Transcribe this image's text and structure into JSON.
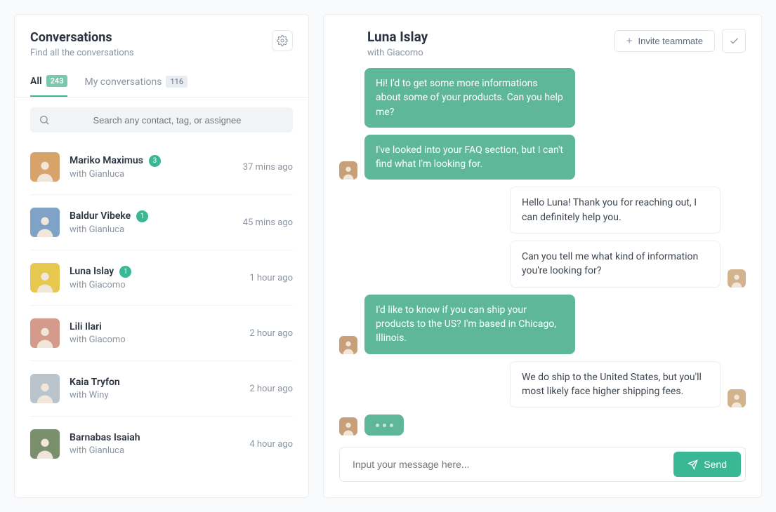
{
  "sidebar": {
    "title": "Conversations",
    "subtitle": "Find all the conversations",
    "tabs": [
      {
        "label": "All",
        "count": "243"
      },
      {
        "label": "My conversations",
        "count": "116"
      }
    ],
    "search_placeholder": "Search any contact, tag, or assignee",
    "conversations": [
      {
        "name": "Mariko Maximus",
        "with": "with Gianluca",
        "unread": "3",
        "time": "37 mins ago",
        "avatar_bg": "#d7a36b"
      },
      {
        "name": "Baldur Vibeke",
        "with": "with Gianluca",
        "unread": "1",
        "time": "45 mins ago",
        "avatar_bg": "#7fa2c7"
      },
      {
        "name": "Luna Islay",
        "with": "with Giacomo",
        "unread": "1",
        "time": "1 hour ago",
        "avatar_bg": "#e7c84e"
      },
      {
        "name": "Lili Ilari",
        "with": "with Giacomo",
        "unread": "",
        "time": "2 hour ago",
        "avatar_bg": "#d49a8b"
      },
      {
        "name": "Kaia Tryfon",
        "with": "with Winy",
        "unread": "",
        "time": "2 hour ago",
        "avatar_bg": "#b9c4cc"
      },
      {
        "name": "Barnabas Isaiah",
        "with": "with Gianluca",
        "unread": "",
        "time": "4 hour ago",
        "avatar_bg": "#7a8f6b"
      }
    ]
  },
  "chat": {
    "title": "Luna Islay",
    "subtitle": "with Giacomo",
    "invite_label": "Invite teammate",
    "messages": [
      {
        "side": "left",
        "color": "green",
        "text": "Hi! I'd to get some more informations about some of your products. Can you help me?",
        "avatar": false
      },
      {
        "side": "left",
        "color": "green",
        "text": "I've looked into your FAQ section, but I can't find what I'm looking for.",
        "avatar": true,
        "avatar_bg": "#c7a07a"
      },
      {
        "side": "right",
        "color": "white",
        "text": "Hello Luna! Thank you for reaching out, I can definitely help you.",
        "avatar": false
      },
      {
        "side": "right",
        "color": "white",
        "text": "Can you tell me what kind of information you're looking for?",
        "avatar": true,
        "avatar_bg": "#d2b38e"
      },
      {
        "side": "left",
        "color": "green",
        "text": "I'd like to know if you can ship your products to the US? I'm based in Chicago, Illinois.",
        "avatar": true,
        "avatar_bg": "#c7a07a"
      },
      {
        "side": "right",
        "color": "white",
        "text": "We do ship to the United States, but you'll most likely face higher shipping fees.",
        "avatar": true,
        "avatar_bg": "#d2b38e"
      }
    ],
    "typing_avatar_bg": "#c7a07a",
    "input_placeholder": "Input your message here...",
    "send_label": "Send"
  }
}
